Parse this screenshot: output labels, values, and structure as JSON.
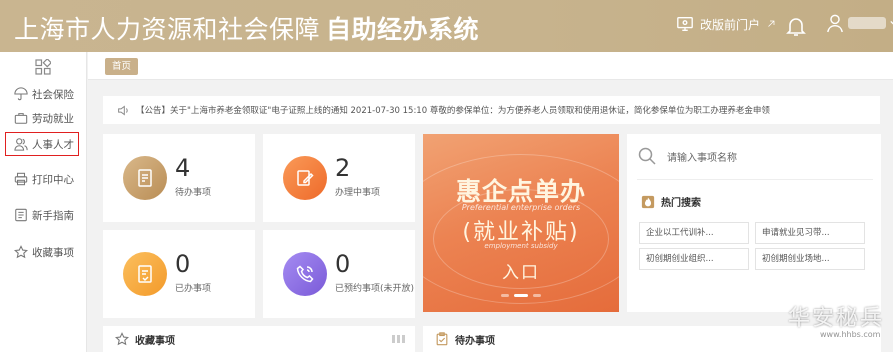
{
  "header": {
    "title_prefix": "上海市人力资源和社会保障",
    "title_bold": "自助经办系统",
    "portal_link": "改版前门户",
    "bg_color": "#c8b48e"
  },
  "sidebar": {
    "items": [
      {
        "label": "社会保险",
        "icon": "umbrella-icon"
      },
      {
        "label": "劳动就业",
        "icon": "briefcase-icon"
      },
      {
        "label": "人事人才",
        "icon": "people-icon",
        "highlighted": true
      },
      {
        "label": "打印中心",
        "icon": "printer-icon"
      },
      {
        "label": "新手指南",
        "icon": "guide-icon"
      },
      {
        "label": "收藏事项",
        "icon": "star-icon"
      }
    ]
  },
  "tabs": {
    "home": "首页"
  },
  "notice": {
    "text": "【公告】关于\"上海市养老金领取证\"电子证照上线的通知  2021-07-30 15:10  尊敬的参保单位：为方便养老人员领取和使用退休证，简化参保单位为职工办理养老金申领"
  },
  "stats": [
    {
      "count": "4",
      "label": "待办事项",
      "color": "#c49a60"
    },
    {
      "count": "2",
      "label": "办理中事项",
      "color": "#f07a38"
    },
    {
      "count": "0",
      "label": "已办事项",
      "color": "#f2a43a"
    },
    {
      "count": "0",
      "label": "已预约事项(未开放)",
      "color": "#8a6fdc"
    }
  ],
  "banner": {
    "title": "惠企点单办",
    "title_en": "Preferential enterprise orders",
    "subtitle": "(就业补贴)",
    "subtitle_en": "employment subsidy",
    "entry": "入口"
  },
  "search": {
    "placeholder": "请输入事项名称",
    "hot_title": "热门搜索",
    "hot_items": [
      "企业以工代训补...",
      "申请就业见习带...",
      "初创期创业组织...",
      "初创期创业场地..."
    ]
  },
  "bottom": {
    "favorites": "收藏事项",
    "todo": "待办事项"
  },
  "watermark": {
    "main": "华安秘兵",
    "sub": "www.hhbs.com"
  }
}
